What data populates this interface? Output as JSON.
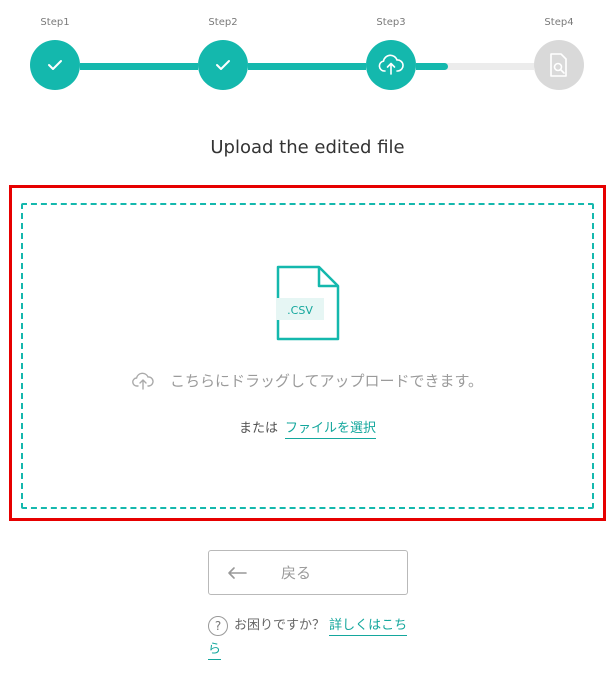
{
  "stepper": {
    "steps": [
      {
        "label": "Step1",
        "status": "done"
      },
      {
        "label": "Step2",
        "status": "done"
      },
      {
        "label": "Step3",
        "status": "active"
      },
      {
        "label": "Step4",
        "status": "pending"
      }
    ]
  },
  "page": {
    "title": "Upload the edited file"
  },
  "upload": {
    "file_badge": ".CSV",
    "drag_text": "こちらにドラッグしてアップロードできます。",
    "or_text": "または",
    "select_link": "ファイルを選択"
  },
  "actions": {
    "back_label": "戻る"
  },
  "help": {
    "question": "お困りですか？",
    "link": "詳しくはこちら"
  },
  "colors": {
    "accent": "#14b8ad",
    "pending": "#d9d9d9",
    "highlight": "#e60000"
  }
}
